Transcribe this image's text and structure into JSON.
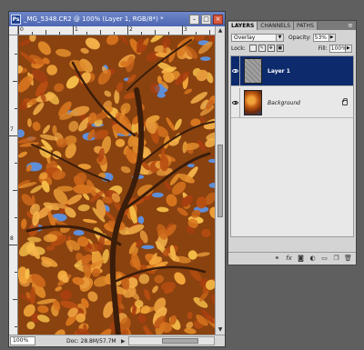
{
  "document": {
    "title": "_MG_5348.CR2 @ 100% (Layer 1, RGB/8*) *",
    "app_icon": "Ps",
    "ruler_top_marks": [
      "0",
      "1",
      "2",
      "3"
    ],
    "ruler_left_marks": [
      "7",
      "8"
    ],
    "zoom": "100%",
    "doc_info": "Doc: 28.8M/57.7M",
    "window_buttons": {
      "minimize": "–",
      "maximize": "□",
      "close": "×"
    }
  },
  "layers_panel": {
    "tabs": [
      "LAYERS",
      "CHANNELS",
      "PATHS"
    ],
    "active_tab": "LAYERS",
    "menu_icon": "≡",
    "blend_mode": "Overlay",
    "opacity_label": "Opacity:",
    "opacity_value": "53%",
    "lock_label": "Lock:",
    "fill_label": "Fill:",
    "fill_value": "100%",
    "layers": [
      {
        "name": "Layer 1",
        "selected": true,
        "visible": true,
        "thumbnail": "gray-noise"
      },
      {
        "name": "Background",
        "selected": false,
        "visible": true,
        "thumbnail": "autumn-photo",
        "locked": true
      }
    ],
    "footer_icons": [
      "link-icon",
      "fx-icon",
      "mask-icon",
      "adjustment-icon",
      "folder-icon",
      "new-layer-icon",
      "trash-icon"
    ]
  },
  "colors": {
    "workspace": "#5f5f5f",
    "titlebar": "#5670bd",
    "selection": "#0c2a6c",
    "leaf_orange": "#e08a2a",
    "sky_blue": "#5f8ed8"
  }
}
